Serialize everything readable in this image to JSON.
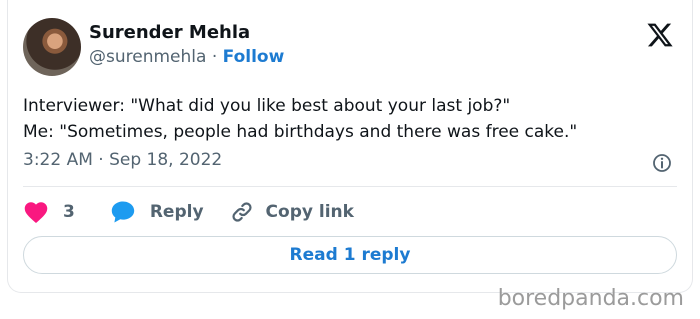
{
  "author": {
    "name": "Surender Mehla",
    "handle": "@surenmehla",
    "separator": "·",
    "follow_label": "Follow"
  },
  "tweet": {
    "lines": [
      "Interviewer: \"What did you like best about your last job?\"",
      "Me: \"Sometimes, people had birthdays and there was free cake.\""
    ],
    "timestamp": "3:22 AM · Sep 18, 2022"
  },
  "actions": {
    "like_count": "3",
    "reply_label": "Reply",
    "copy_label": "Copy link"
  },
  "read_reply_label": "Read 1 reply",
  "watermark": "boredpanda.com",
  "icons": {
    "logo": "x-logo-icon",
    "info": "info-icon",
    "like": "heart-icon",
    "reply": "speech-bubble-icon",
    "copy": "link-icon"
  },
  "colors": {
    "accent": "#1d7bd1",
    "heart": "#f91880",
    "text": "#0f1419",
    "muted": "#536471"
  }
}
